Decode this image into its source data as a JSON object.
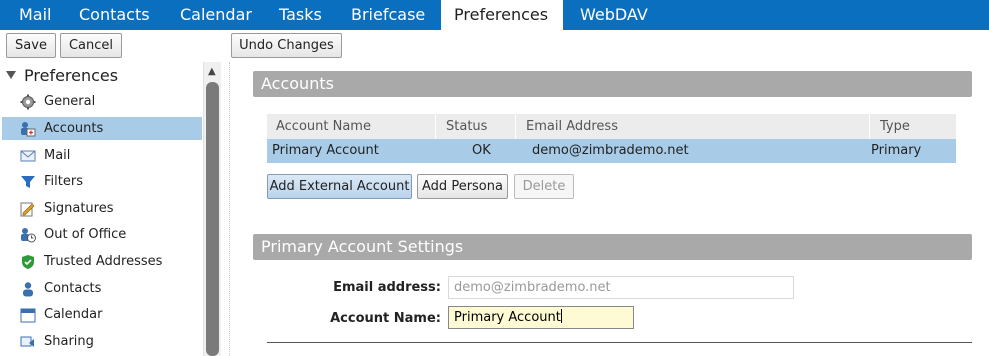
{
  "app_tabs": [
    {
      "label": "Mail",
      "active": false
    },
    {
      "label": "Contacts",
      "active": false
    },
    {
      "label": "Calendar",
      "active": false
    },
    {
      "label": "Tasks",
      "active": false
    },
    {
      "label": "Briefcase",
      "active": false
    },
    {
      "label": "Preferences",
      "active": true
    },
    {
      "label": "WebDAV",
      "active": false
    }
  ],
  "toolbar": {
    "save_label": "Save",
    "cancel_label": "Cancel",
    "undo_label": "Undo Changes"
  },
  "sidebar": {
    "header": "Preferences",
    "items": [
      {
        "label": "General",
        "icon": "gear-icon"
      },
      {
        "label": "Accounts",
        "icon": "accounts-icon",
        "selected": true
      },
      {
        "label": "Mail",
        "icon": "envelope-icon"
      },
      {
        "label": "Filters",
        "icon": "filter-icon"
      },
      {
        "label": "Signatures",
        "icon": "signature-icon"
      },
      {
        "label": "Out of Office",
        "icon": "out-of-office-icon"
      },
      {
        "label": "Trusted Addresses",
        "icon": "shield-icon"
      },
      {
        "label": "Contacts",
        "icon": "person-icon"
      },
      {
        "label": "Calendar",
        "icon": "calendar-icon"
      },
      {
        "label": "Sharing",
        "icon": "sharing-icon"
      }
    ]
  },
  "accounts": {
    "title": "Accounts",
    "columns": [
      "Account Name",
      "Status",
      "Email Address",
      "Type"
    ],
    "rows": [
      {
        "name": "Primary Account",
        "status": "OK",
        "email": "demo@zimbrademo.net",
        "type": "Primary"
      }
    ],
    "add_external_label": "Add External Account",
    "add_persona_label": "Add Persona",
    "delete_label": "Delete"
  },
  "settings": {
    "title": "Primary Account Settings",
    "email_label": "Email address:",
    "email_value": "demo@zimbrademo.net",
    "account_name_label": "Account Name:",
    "account_name_value": "Primary Account"
  },
  "colors": {
    "tabbar": "#0b6fc0",
    "selection": "#a8cce8",
    "section_bar": "#a9a9a9"
  }
}
